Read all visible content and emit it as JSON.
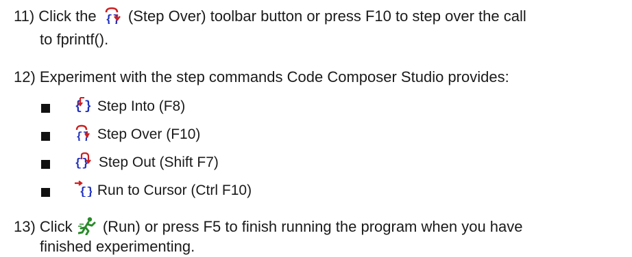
{
  "colors": {
    "text": "#1a1a1a",
    "icon_red": "#cc1f1f",
    "icon_blue": "#1d2fbf",
    "run_green": "#2a8a2a"
  },
  "step11": {
    "number": "11)",
    "before_icon": "Click the",
    "icon": "step-over-icon",
    "after_icon": "(Step Over) toolbar button or press F10 to step over the call",
    "line2": "to fprintf()."
  },
  "step12": {
    "number": "12)",
    "text": "Experiment with the step commands Code Composer Studio provides:",
    "items": [
      {
        "icon": "step-into-icon",
        "label": "Step Into (F8)"
      },
      {
        "icon": "step-over-icon",
        "label": "Step Over (F10)"
      },
      {
        "icon": "step-out-icon",
        "label": "Step Out (Shift F7)"
      },
      {
        "icon": "run-to-cursor-icon",
        "label": "Run to Cursor (Ctrl F10)"
      }
    ]
  },
  "step13": {
    "number": "13)",
    "before_icon": "Click",
    "icon": "run-icon",
    "after_icon": "(Run) or press F5 to finish running the program when you have",
    "line2": "finished experimenting."
  }
}
